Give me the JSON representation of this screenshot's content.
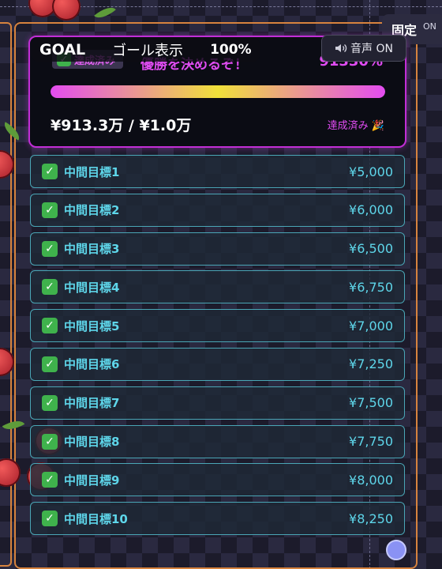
{
  "fixed_button": {
    "label": "固定",
    "state": "ON"
  },
  "goal_overlay": {
    "goal": "GOAL",
    "display_label": "ゴール表示",
    "percent": "100%"
  },
  "sound_button": {
    "icon": "speaker-icon",
    "label": "音声 ON"
  },
  "goal_card": {
    "achieved_badge": "達成済み",
    "title": "優勝を決めるぞ！",
    "percent": "91330%",
    "progress_fraction": 1.0,
    "amount": "¥913.3万 / ¥1.0万",
    "done_label": "達成済み 🎉"
  },
  "milestones": [
    {
      "label": "中間目標1",
      "amount": "¥5,000",
      "achieved": true
    },
    {
      "label": "中間目標2",
      "amount": "¥6,000",
      "achieved": true
    },
    {
      "label": "中間目標3",
      "amount": "¥6,500",
      "achieved": true
    },
    {
      "label": "中間目標4",
      "amount": "¥6,750",
      "achieved": true
    },
    {
      "label": "中間目標5",
      "amount": "¥7,000",
      "achieved": true
    },
    {
      "label": "中間目標6",
      "amount": "¥7,250",
      "achieved": true
    },
    {
      "label": "中間目標7",
      "amount": "¥7,500",
      "achieved": true
    },
    {
      "label": "中間目標8",
      "amount": "¥7,750",
      "achieved": true
    },
    {
      "label": "中間目標9",
      "amount": "¥8,000",
      "achieved": true
    },
    {
      "label": "中間目標10",
      "amount": "¥8,250",
      "achieved": true
    }
  ],
  "colors": {
    "accent_magenta": "#e04cf2",
    "milestone_cyan": "#5ed6ea",
    "frame_orange": "#d7833e",
    "check_green": "#3fb24c"
  }
}
